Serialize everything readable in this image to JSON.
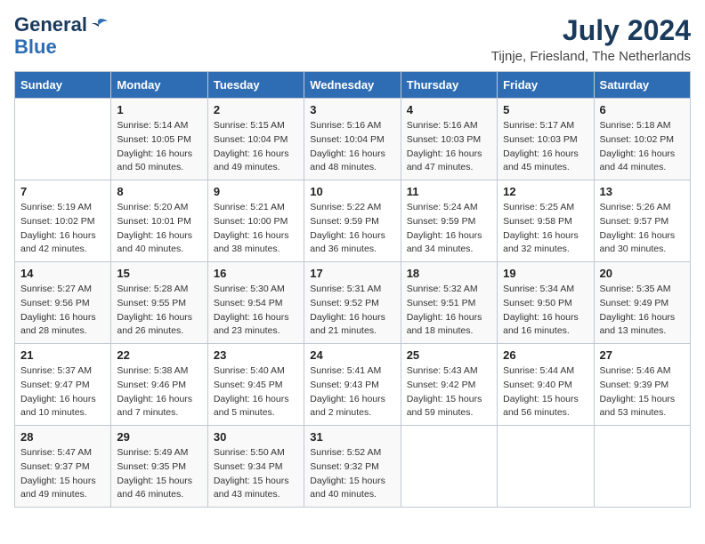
{
  "logo": {
    "line1": "General",
    "line2": "Blue"
  },
  "title": "July 2024",
  "location": "Tijnje, Friesland, The Netherlands",
  "headers": [
    "Sunday",
    "Monday",
    "Tuesday",
    "Wednesday",
    "Thursday",
    "Friday",
    "Saturday"
  ],
  "weeks": [
    [
      {
        "day": "",
        "info": ""
      },
      {
        "day": "1",
        "info": "Sunrise: 5:14 AM\nSunset: 10:05 PM\nDaylight: 16 hours\nand 50 minutes."
      },
      {
        "day": "2",
        "info": "Sunrise: 5:15 AM\nSunset: 10:04 PM\nDaylight: 16 hours\nand 49 minutes."
      },
      {
        "day": "3",
        "info": "Sunrise: 5:16 AM\nSunset: 10:04 PM\nDaylight: 16 hours\nand 48 minutes."
      },
      {
        "day": "4",
        "info": "Sunrise: 5:16 AM\nSunset: 10:03 PM\nDaylight: 16 hours\nand 47 minutes."
      },
      {
        "day": "5",
        "info": "Sunrise: 5:17 AM\nSunset: 10:03 PM\nDaylight: 16 hours\nand 45 minutes."
      },
      {
        "day": "6",
        "info": "Sunrise: 5:18 AM\nSunset: 10:02 PM\nDaylight: 16 hours\nand 44 minutes."
      }
    ],
    [
      {
        "day": "7",
        "info": "Sunrise: 5:19 AM\nSunset: 10:02 PM\nDaylight: 16 hours\nand 42 minutes."
      },
      {
        "day": "8",
        "info": "Sunrise: 5:20 AM\nSunset: 10:01 PM\nDaylight: 16 hours\nand 40 minutes."
      },
      {
        "day": "9",
        "info": "Sunrise: 5:21 AM\nSunset: 10:00 PM\nDaylight: 16 hours\nand 38 minutes."
      },
      {
        "day": "10",
        "info": "Sunrise: 5:22 AM\nSunset: 9:59 PM\nDaylight: 16 hours\nand 36 minutes."
      },
      {
        "day": "11",
        "info": "Sunrise: 5:24 AM\nSunset: 9:59 PM\nDaylight: 16 hours\nand 34 minutes."
      },
      {
        "day": "12",
        "info": "Sunrise: 5:25 AM\nSunset: 9:58 PM\nDaylight: 16 hours\nand 32 minutes."
      },
      {
        "day": "13",
        "info": "Sunrise: 5:26 AM\nSunset: 9:57 PM\nDaylight: 16 hours\nand 30 minutes."
      }
    ],
    [
      {
        "day": "14",
        "info": "Sunrise: 5:27 AM\nSunset: 9:56 PM\nDaylight: 16 hours\nand 28 minutes."
      },
      {
        "day": "15",
        "info": "Sunrise: 5:28 AM\nSunset: 9:55 PM\nDaylight: 16 hours\nand 26 minutes."
      },
      {
        "day": "16",
        "info": "Sunrise: 5:30 AM\nSunset: 9:54 PM\nDaylight: 16 hours\nand 23 minutes."
      },
      {
        "day": "17",
        "info": "Sunrise: 5:31 AM\nSunset: 9:52 PM\nDaylight: 16 hours\nand 21 minutes."
      },
      {
        "day": "18",
        "info": "Sunrise: 5:32 AM\nSunset: 9:51 PM\nDaylight: 16 hours\nand 18 minutes."
      },
      {
        "day": "19",
        "info": "Sunrise: 5:34 AM\nSunset: 9:50 PM\nDaylight: 16 hours\nand 16 minutes."
      },
      {
        "day": "20",
        "info": "Sunrise: 5:35 AM\nSunset: 9:49 PM\nDaylight: 16 hours\nand 13 minutes."
      }
    ],
    [
      {
        "day": "21",
        "info": "Sunrise: 5:37 AM\nSunset: 9:47 PM\nDaylight: 16 hours\nand 10 minutes."
      },
      {
        "day": "22",
        "info": "Sunrise: 5:38 AM\nSunset: 9:46 PM\nDaylight: 16 hours\nand 7 minutes."
      },
      {
        "day": "23",
        "info": "Sunrise: 5:40 AM\nSunset: 9:45 PM\nDaylight: 16 hours\nand 5 minutes."
      },
      {
        "day": "24",
        "info": "Sunrise: 5:41 AM\nSunset: 9:43 PM\nDaylight: 16 hours\nand 2 minutes."
      },
      {
        "day": "25",
        "info": "Sunrise: 5:43 AM\nSunset: 9:42 PM\nDaylight: 15 hours\nand 59 minutes."
      },
      {
        "day": "26",
        "info": "Sunrise: 5:44 AM\nSunset: 9:40 PM\nDaylight: 15 hours\nand 56 minutes."
      },
      {
        "day": "27",
        "info": "Sunrise: 5:46 AM\nSunset: 9:39 PM\nDaylight: 15 hours\nand 53 minutes."
      }
    ],
    [
      {
        "day": "28",
        "info": "Sunrise: 5:47 AM\nSunset: 9:37 PM\nDaylight: 15 hours\nand 49 minutes."
      },
      {
        "day": "29",
        "info": "Sunrise: 5:49 AM\nSunset: 9:35 PM\nDaylight: 15 hours\nand 46 minutes."
      },
      {
        "day": "30",
        "info": "Sunrise: 5:50 AM\nSunset: 9:34 PM\nDaylight: 15 hours\nand 43 minutes."
      },
      {
        "day": "31",
        "info": "Sunrise: 5:52 AM\nSunset: 9:32 PM\nDaylight: 15 hours\nand 40 minutes."
      },
      {
        "day": "",
        "info": ""
      },
      {
        "day": "",
        "info": ""
      },
      {
        "day": "",
        "info": ""
      }
    ]
  ]
}
